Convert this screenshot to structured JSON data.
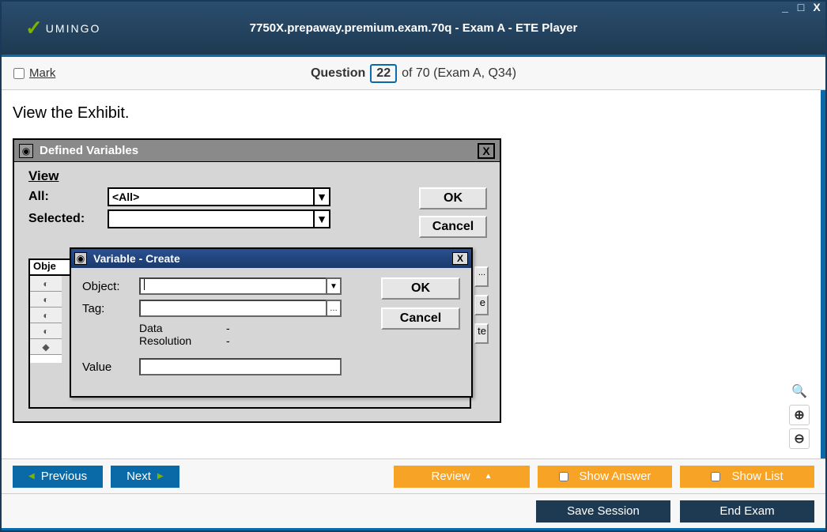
{
  "window": {
    "min": "_",
    "max": "□",
    "close": "X"
  },
  "brand": {
    "check": "✓",
    "name": "UMINGO"
  },
  "title": "7750X.prepaway.premium.exam.70q - Exam A - ETE Player",
  "question_bar": {
    "mark_label": "Mark",
    "word": "Question",
    "number": "22",
    "suffix": "of 70 (Exam A, Q34)"
  },
  "prompt": "View the Exhibit.",
  "exhibit": {
    "title": "Defined Variables",
    "close": "X",
    "view_label": "View",
    "all_label": "All:",
    "all_value": "<All>",
    "selected_label": "Selected:",
    "selected_value": "",
    "ok": "OK",
    "cancel": "Cancel",
    "obj_header": "Obje",
    "partial_btn": "e",
    "partial_btn2": "te"
  },
  "dialog": {
    "title": "Variable - Create",
    "close": "X",
    "object_label": "Object:",
    "object_value": "",
    "tag_label": "Tag:",
    "tag_value": "",
    "data_label": "Data",
    "data_value": "-",
    "res_label": "Resolution",
    "res_value": "-",
    "value_label": "Value",
    "value_value": "",
    "ok": "OK",
    "cancel": "Cancel"
  },
  "nav": {
    "previous": "Previous",
    "next": "Next",
    "review": "Review",
    "show_answer": "Show Answer",
    "show_list": "Show List",
    "save_session": "Save Session",
    "end_exam": "End Exam"
  }
}
